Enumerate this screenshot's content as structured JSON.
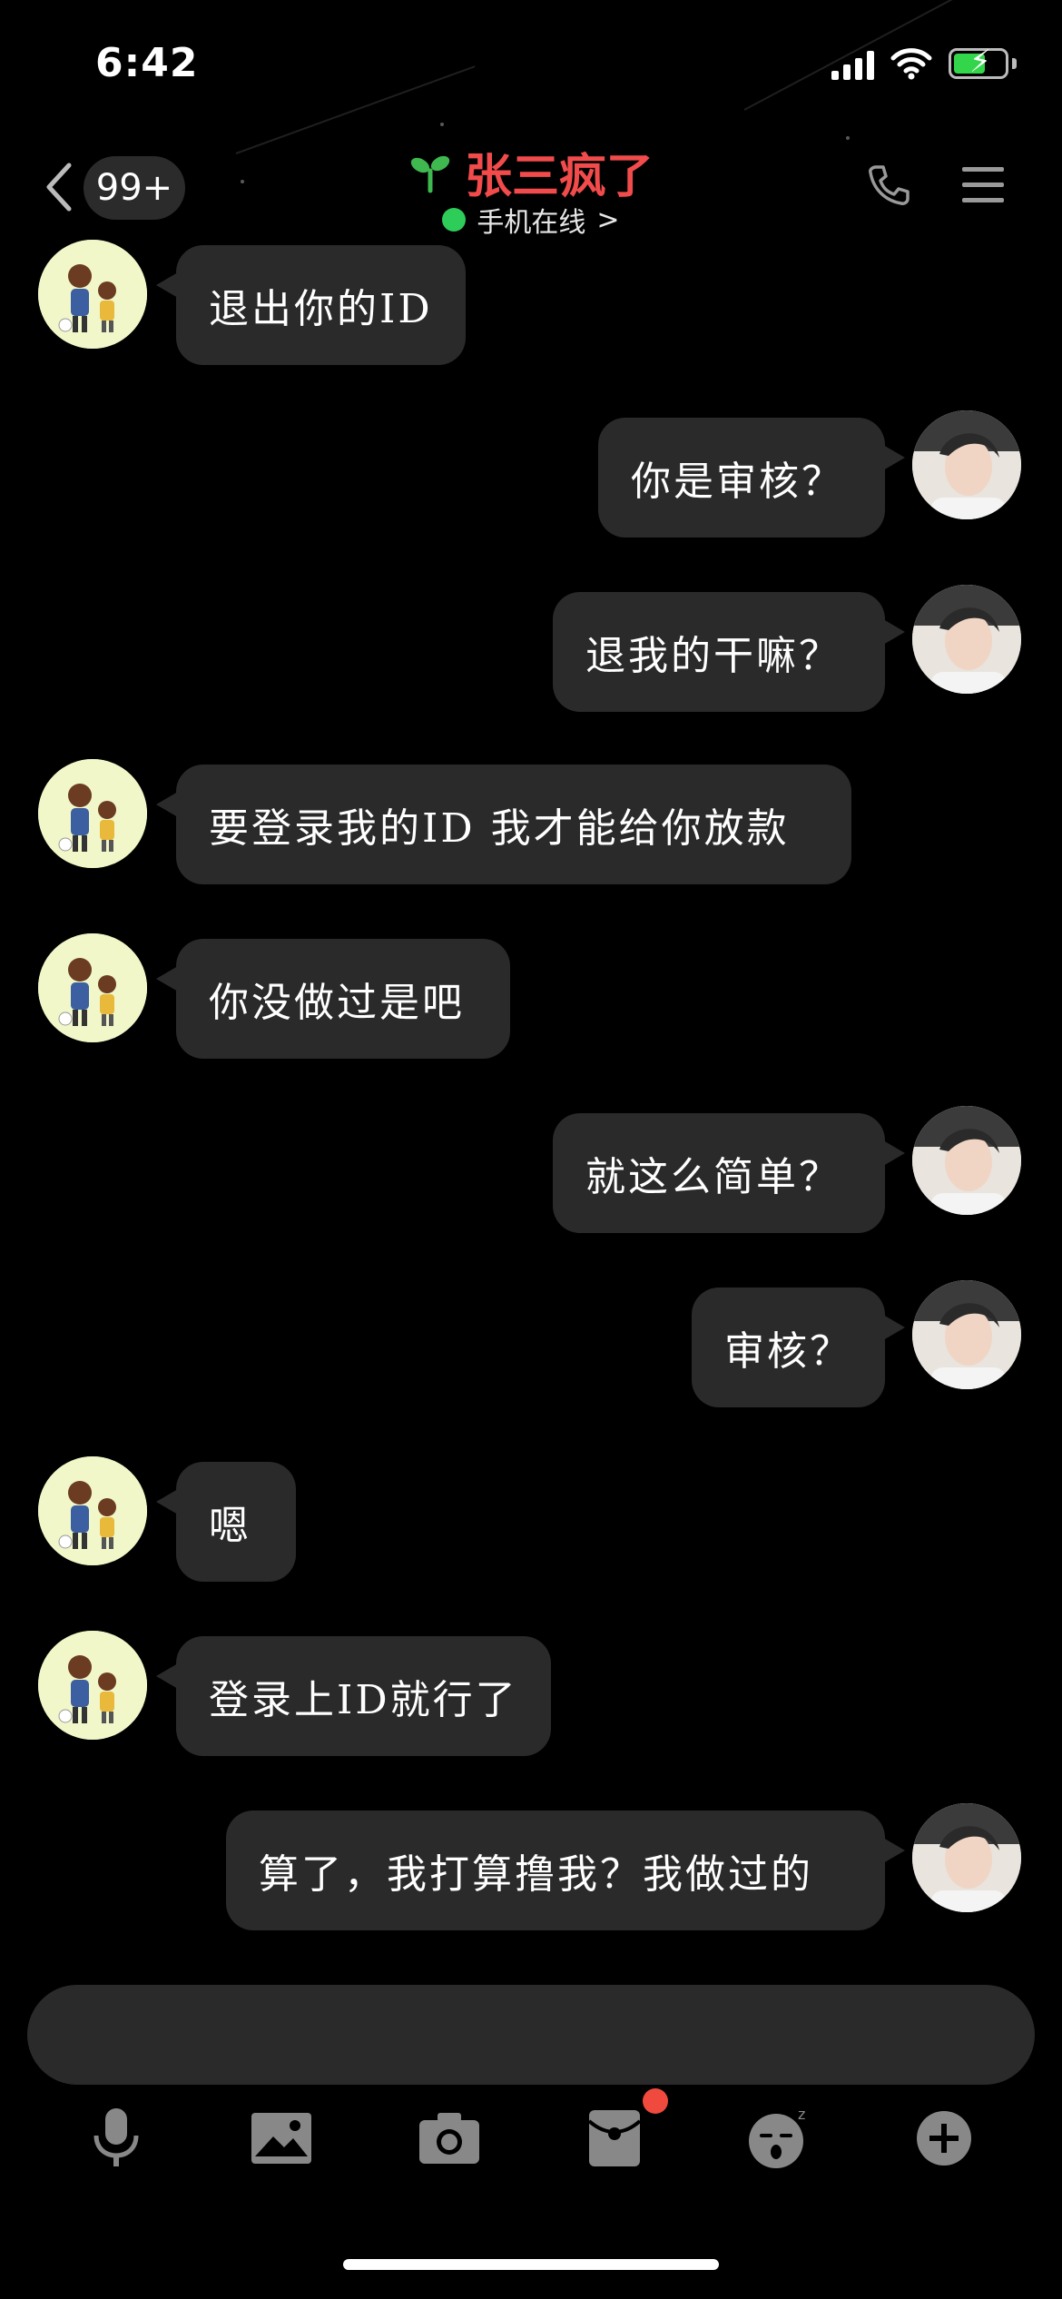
{
  "status_bar": {
    "time": "6:42"
  },
  "header": {
    "unread_badge": "99+",
    "title": "张三疯了",
    "subtitle": "手机在线",
    "subtitle_chevron": ">",
    "icons": {
      "back": "chevron-left-icon",
      "sprout": "sprout-icon",
      "call": "phone-icon",
      "menu": "menu-icon"
    }
  },
  "messages": [
    {
      "side": "left",
      "text": "退出你的ID"
    },
    {
      "side": "right",
      "text": "你是审核？"
    },
    {
      "side": "right",
      "text": "退我的干嘛？"
    },
    {
      "side": "left",
      "text": "要登录我的ID 我才能给你放款"
    },
    {
      "side": "left",
      "text": "你没做过是吧"
    },
    {
      "side": "right",
      "text": "就这么简单？"
    },
    {
      "side": "right",
      "text": "审核？"
    },
    {
      "side": "left",
      "text": "嗯"
    },
    {
      "side": "left",
      "text": "登录上ID就行了"
    },
    {
      "side": "right",
      "text": "算了，我打算撸我？我做过的"
    }
  ],
  "input": {
    "placeholder": ""
  },
  "toolbar": {
    "items": [
      "microphone-icon",
      "image-icon",
      "camera-icon",
      "red-packet-icon",
      "sleepy-emoji-icon",
      "add-icon"
    ]
  },
  "colors": {
    "title": "#f14b4b",
    "online": "#2ecc59",
    "bubble": "#2a2a2a",
    "notification": "#f04a3e",
    "battery": "#33d64b"
  }
}
